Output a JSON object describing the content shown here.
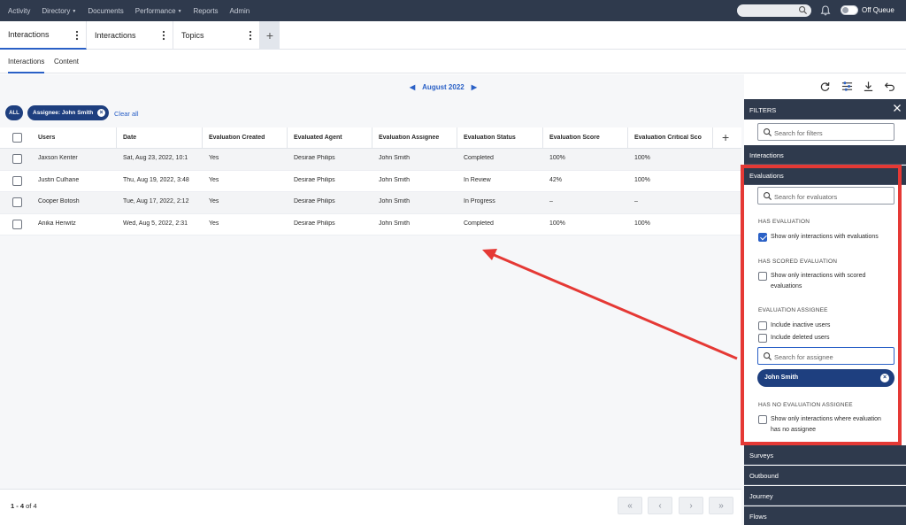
{
  "nav": {
    "items": [
      {
        "label": "Activity",
        "caret": false
      },
      {
        "label": "Directory",
        "caret": true
      },
      {
        "label": "Documents",
        "caret": false
      },
      {
        "label": "Performance",
        "caret": true
      },
      {
        "label": "Reports",
        "caret": false
      },
      {
        "label": "Admin",
        "caret": false
      }
    ],
    "status_label": "Off Queue",
    "colors": {
      "bar": "#2f3a4d",
      "accent": "#2a60c6"
    }
  },
  "workspace_tabs": [
    {
      "label": "Interactions",
      "active": true
    },
    {
      "label": "Interactions",
      "active": false
    },
    {
      "label": "Topics",
      "active": false
    }
  ],
  "workspace_add": "+",
  "sub_tabs": [
    {
      "label": "Interactions",
      "active": true
    },
    {
      "label": "Content",
      "active": false
    }
  ],
  "date_nav": {
    "prev": "◀",
    "label": "August 2022",
    "next": "▶"
  },
  "filter_pills": {
    "all": "ALL",
    "assignee": "Assignee: John Smith",
    "clear_all": "Clear all"
  },
  "table": {
    "columns": [
      "Users",
      "Date",
      "Evaluation Created",
      "Evaluated Agent",
      "Evaluation Assignee",
      "Evaluation Status",
      "Evaluation Score",
      "Evaluation Critical Sco"
    ],
    "add_column": "+",
    "rows": [
      [
        "Jaxson Kenter",
        "Sat, Aug 23, 2022, 10:1",
        "Yes",
        "Desirae Philips",
        "John Smith",
        "Completed",
        "100%",
        "100%"
      ],
      [
        "Justin Culhane",
        "Thu, Aug 19, 2022, 3:48",
        "Yes",
        "Desirae Philips",
        "John Smith",
        "In Review",
        "42%",
        "100%"
      ],
      [
        "Cooper Botosh",
        "Tue, Aug 17, 2022, 2:12",
        "Yes",
        "Desirae Philips",
        "John Smith",
        "In Progress",
        "–",
        "–"
      ],
      [
        "Anika Herwitz",
        "Wed, Aug 5, 2022, 2:31",
        "Yes",
        "Desirae Philips",
        "John Smith",
        "Completed",
        "100%",
        "100%"
      ]
    ]
  },
  "pagination": {
    "range": "1 - 4",
    "of_text": "of 4",
    "buttons": [
      "«",
      "‹",
      "›",
      "»"
    ]
  },
  "filters_panel": {
    "title": "FILTERS",
    "search_placeholder": "Search for filters",
    "sections_top": [
      "Interactions",
      "Evaluations"
    ],
    "evaluator_placeholder": "Search for evaluators",
    "has_evaluation": {
      "heading": "HAS EVALUATION",
      "option": "Show only interactions with evaluations",
      "checked": true
    },
    "has_scored": {
      "heading": "HAS SCORED EVALUATION",
      "option_line1": "Show only interactions with scored",
      "option_line2": "evaluations",
      "checked": false
    },
    "assignee": {
      "heading": "EVALUATION ASSIGNEE",
      "inactive": "Include inactive users",
      "deleted": "Include deleted users",
      "search_placeholder": "Search for assignee",
      "chip": "John Smith"
    },
    "no_assignee": {
      "heading": "HAS NO EVALUATION ASSIGNEE",
      "option_line1": "Show only interactions where evaluation",
      "option_line2": "has no assignee",
      "checked": false
    },
    "sections_bottom": [
      "Surveys",
      "Outbound",
      "Journey",
      "Flows"
    ]
  }
}
